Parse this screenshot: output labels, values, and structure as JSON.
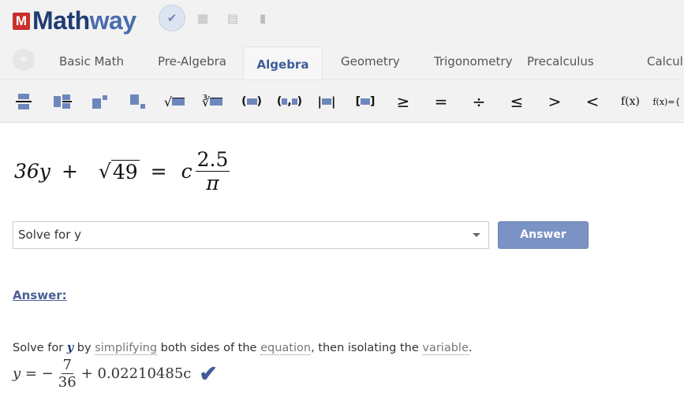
{
  "header": {
    "logo_letter": "M",
    "logo_text_a": "Math",
    "logo_text_b": "way",
    "icons": [
      "check-document-icon",
      "grid-icon",
      "document-icon",
      "copy-icon"
    ]
  },
  "tabs": [
    {
      "label": "Basic Math"
    },
    {
      "label": "Pre-Algebra"
    },
    {
      "label": "Algebra",
      "active": true
    },
    {
      "label": "Geometry"
    },
    {
      "label": "Trigonometry"
    },
    {
      "label": "Precalculus"
    },
    {
      "label": "Calculu"
    }
  ],
  "toolbar": {
    "symbols": {
      "geq": "≥",
      "eq": "=",
      "div": "÷",
      "leq": "≤",
      "gt": ">",
      "lt": "<",
      "fx": "f(x)",
      "fxp": "f(x)={"
    }
  },
  "expression": {
    "lhs1": "36y",
    "plus": "+",
    "sqrt_arg": "49",
    "equals": "=",
    "c": "c",
    "frac_num": "2.5",
    "frac_den": "π"
  },
  "solve_select": {
    "value": "Solve for y"
  },
  "answer_button": "Answer",
  "answer_heading": "Answer:",
  "explanation": {
    "p1": "Solve for ",
    "var": "y",
    "p2": " by ",
    "t1": "simplifying",
    "p3": " both sides of the ",
    "t2": "equation",
    "p4": ", then isolating the ",
    "t3": "variable",
    "p5": "."
  },
  "result": {
    "lhs": "y = −",
    "num": "7",
    "den": "36",
    "rest": "+ 0.02210485c"
  },
  "colors": {
    "accent": "#3e5c99",
    "button": "#7a92c4",
    "logo_red": "#c9302c"
  }
}
